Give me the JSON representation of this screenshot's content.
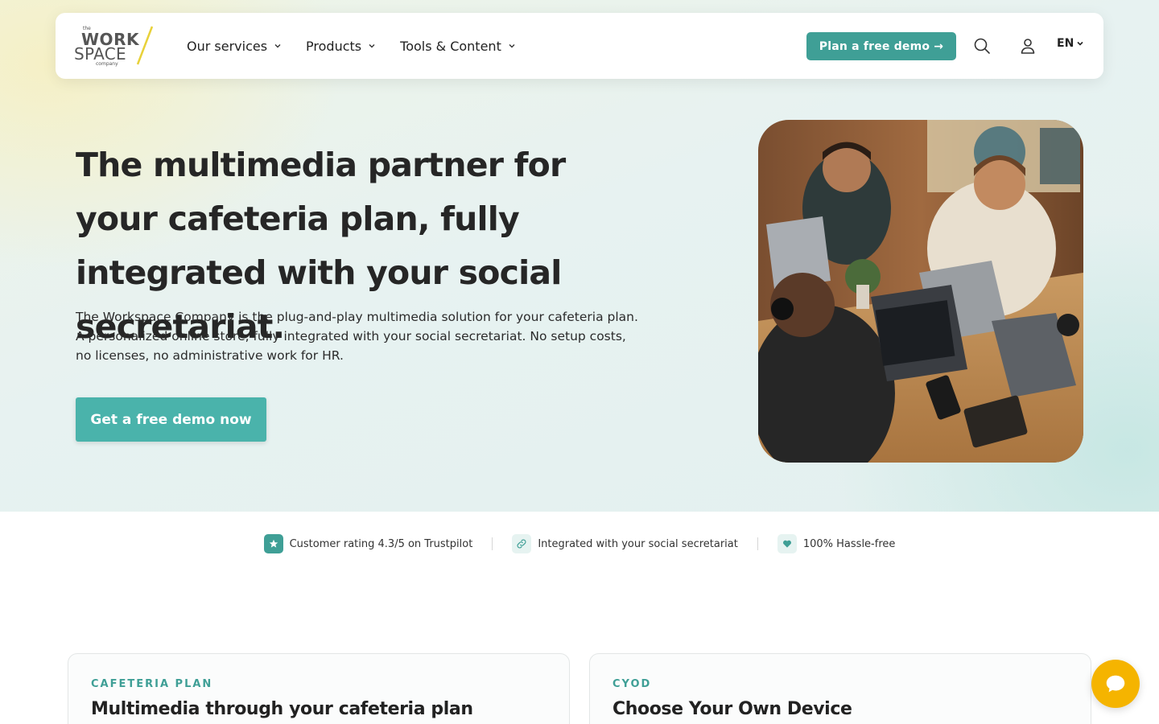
{
  "logo": {
    "small_top": "the",
    "line1": "WORK",
    "line2": "SPACE",
    "small_bottom": "company"
  },
  "nav": {
    "items": [
      {
        "label": "Our services"
      },
      {
        "label": "Products"
      },
      {
        "label": "Tools & Content"
      }
    ],
    "demo_button": "Plan a free demo →",
    "language": "EN"
  },
  "hero": {
    "title": "The multimedia partner for your cafeteria plan, fully integrated with your social secretariat.",
    "subtitle": "The Workspace Company is the plug-and-play multimedia solution for your cafeteria plan. A personalized online store, fully integrated with your social secretariat. No setup costs, no licenses, no administrative work for HR.",
    "cta": "Get a free demo now"
  },
  "badges": [
    {
      "icon": "star-icon",
      "text": "Customer rating 4.3/5 on Trustpilot"
    },
    {
      "icon": "link-icon",
      "text": "Integrated with your social secretariat"
    },
    {
      "icon": "heart-icon",
      "text": "100% Hassle-free"
    }
  ],
  "cards": [
    {
      "eyebrow": "CAFETERIA PLAN",
      "title": "Multimedia through your cafeteria plan"
    },
    {
      "eyebrow": "CYOD",
      "title": "Choose Your Own Device"
    }
  ],
  "colors": {
    "accent": "#3f9f96",
    "cta": "#4ab3ab",
    "chat": "#f5b400",
    "logo_slash": "#e8d13a"
  }
}
